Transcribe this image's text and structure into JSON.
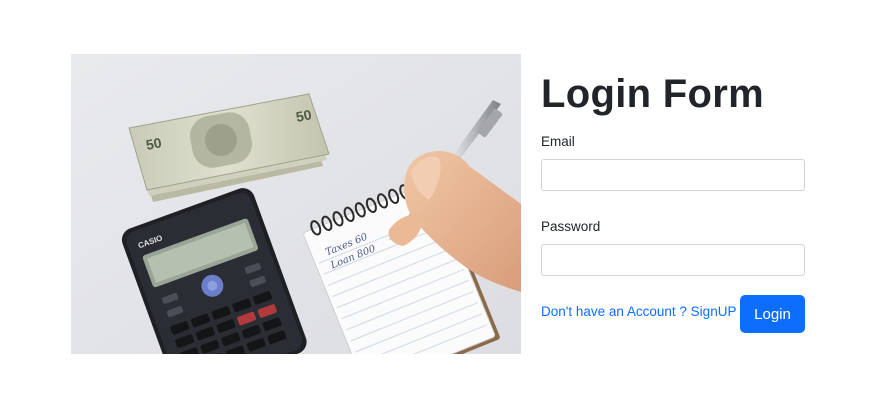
{
  "form": {
    "title": "Login Form",
    "email_label": "Email",
    "email_value": "",
    "password_label": "Password",
    "password_value": "",
    "signup_text": "Don't have an Account ? SignUP",
    "login_label": "Login"
  },
  "hero_image": {
    "banknote_text": "50",
    "calculator_brand": "CASIO",
    "note_handwriting_1": "Taxes 60",
    "note_handwriting_2": "Loan 800"
  },
  "colors": {
    "accent": "#0d6efd",
    "text": "#212529",
    "input_border": "#ced4da"
  }
}
